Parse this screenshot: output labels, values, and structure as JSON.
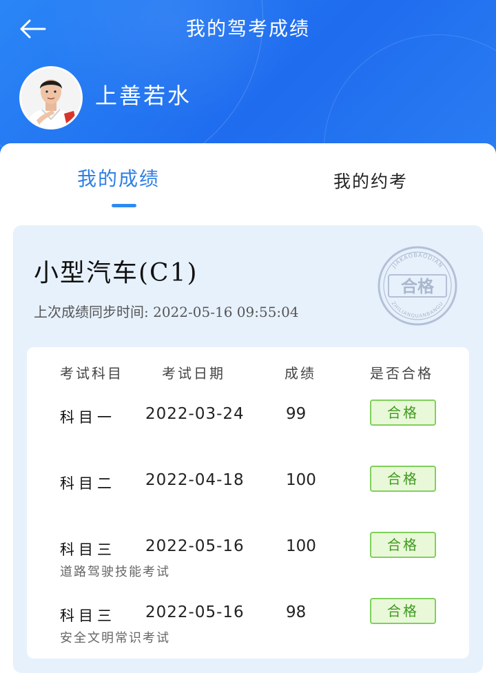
{
  "header": {
    "title": "我的驾考成绩",
    "username": "上善若水"
  },
  "tabs": [
    {
      "label": "我的成绩",
      "active": true
    },
    {
      "label": "我的约考",
      "active": false
    }
  ],
  "vehicle": {
    "title": "小型汽车(C1)",
    "sync_label": "上次成绩同步时间:",
    "sync_time": "2022-05-16 09:55:04"
  },
  "stamp": {
    "text": "合格",
    "top_arc": "JIAKAOBAODIAN",
    "bottom_arc": "ZHILIANQUANBANGU"
  },
  "table": {
    "headers": [
      "考试科目",
      "考试日期",
      "成绩",
      "是否合格"
    ],
    "rows": [
      {
        "subject": "科目一",
        "note": "",
        "date": "2022-03-24",
        "score": "99",
        "result": "合格"
      },
      {
        "subject": "科目二",
        "note": "",
        "date": "2022-04-18",
        "score": "100",
        "result": "合格"
      },
      {
        "subject": "科目三",
        "note": "道路驾驶技能考试",
        "date": "2022-05-16",
        "score": "100",
        "result": "合格"
      },
      {
        "subject": "科目三",
        "note": "安全文明常识考试",
        "date": "2022-05-16",
        "score": "98",
        "result": "合格"
      }
    ]
  },
  "colors": {
    "header_blue": "#1f6cef",
    "accent_blue": "#2e7fe6",
    "pass_green": "#3d9a1f"
  }
}
